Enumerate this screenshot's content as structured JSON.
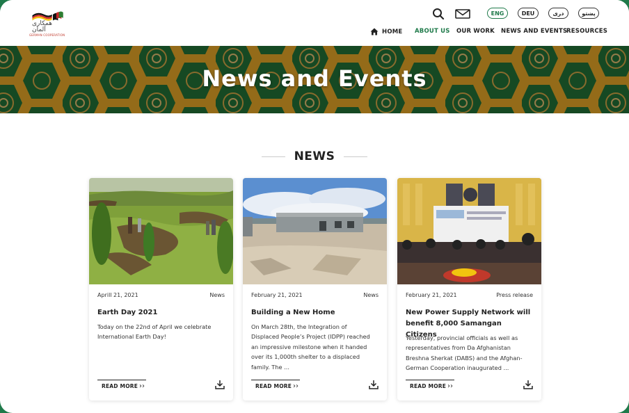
{
  "header": {
    "logo_text": "همکاری آلمان",
    "logo_sub": "GERMAN COOPERATION",
    "languages": [
      {
        "label": "ENG",
        "active": true
      },
      {
        "label": "DEU",
        "active": false
      },
      {
        "label": "دری",
        "active": false
      },
      {
        "label": "پښتو",
        "active": false
      }
    ],
    "nav": [
      {
        "label": "HOME",
        "icon": "home-icon",
        "active": false
      },
      {
        "label": "ABOUT US",
        "active": true
      },
      {
        "label": "OUR WORK",
        "active": false
      },
      {
        "label": "NEWS AND EVENTS",
        "active": false
      },
      {
        "label": "RESOURCES",
        "active": false
      }
    ],
    "icons": [
      "search-icon",
      "mail-icon"
    ]
  },
  "banner": {
    "title": "News and Events"
  },
  "section": {
    "title": "NEWS"
  },
  "cards": [
    {
      "date": "Aprill 21, 2021",
      "category": "News",
      "title": "Earth Day 2021",
      "body": "Today on the 22nd of April we celebrate International Earth Day!",
      "read_more": "READ MORE"
    },
    {
      "date": "February 21, 2021",
      "category": "News",
      "title": "Building a New Home",
      "body": "On March 28th, the Integration of Displaced People’s Project (IDPP) reached an impressive milestone when it handed over its 1,000th shelter to a displaced family. The  ...",
      "read_more": "READ MORE"
    },
    {
      "date": "February 21, 2021",
      "category": "Press release",
      "title": "New Power Supply Network will benefit 8,000 Samangan Citizens",
      "body": "Yesterday, provincial officials as well as representatives from Da Afghanistan Breshna Sherkat (DABS) and the Afghan-German Cooperation inaugurated  ...",
      "read_more": "READ MORE"
    }
  ],
  "colors": {
    "accent": "#1f7a4a",
    "text": "#222222"
  }
}
